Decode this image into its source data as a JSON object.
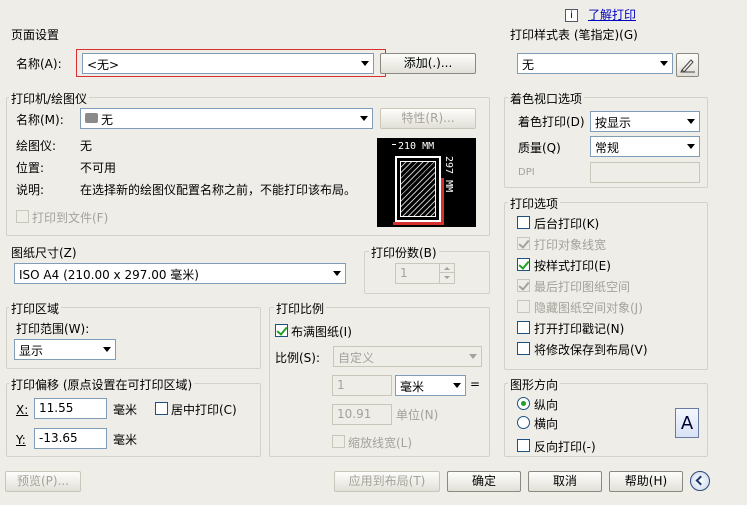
{
  "help_link": {
    "icon": "info-icon",
    "label": "了解打印"
  },
  "page_setup": {
    "title": "页面设置",
    "name_label": "名称(A):",
    "name_value": "<无>",
    "add_button": "添加(.)..."
  },
  "printer": {
    "title": "打印机/绘图仪",
    "name_label": "名称(M):",
    "name_value": "无",
    "properties_button": "特性(R)...",
    "plotter_label": "绘图仪:",
    "plotter_value": "无",
    "location_label": "位置:",
    "location_value": "不可用",
    "description_label": "说明:",
    "description_value": "在选择新的绘图仪配置名称之前，不能打印该布局。",
    "print_to_file": "打印到文件(F)",
    "preview_width": "210 MM",
    "preview_height": "297 MM"
  },
  "paper_size": {
    "title": "图纸尺寸(Z)",
    "value": "ISO A4 (210.00 x 297.00 毫米)"
  },
  "copies": {
    "title": "打印份数(B)",
    "value": "1"
  },
  "plot_area": {
    "title": "打印区域",
    "range_label": "打印范围(W):",
    "range_value": "显示"
  },
  "plot_offset": {
    "title": "打印偏移 (原点设置在可打印区域)",
    "x_label": "X:",
    "x_value": "11.55",
    "x_unit": "毫米",
    "y_label": "Y:",
    "y_value": "-13.65",
    "y_unit": "毫米",
    "center": "居中打印(C)"
  },
  "plot_scale": {
    "title": "打印比例",
    "fit_paper": "布满图纸(I)",
    "scale_label": "比例(S):",
    "scale_value": "自定义",
    "value1": "1",
    "unit1": "毫米",
    "equals": "=",
    "value2": "10.91",
    "unit2": "单位(N)",
    "scale_lineweights": "缩放线宽(L)"
  },
  "style_table": {
    "title": "打印样式表 (笔指定)(G)",
    "value": "无"
  },
  "shaded_viewport": {
    "title": "着色视口选项",
    "shade_label": "着色打印(D)",
    "shade_value": "按显示",
    "quality_label": "质量(Q)",
    "quality_value": "常规",
    "dpi_label": "DPI"
  },
  "plot_options": {
    "title": "打印选项",
    "items": [
      {
        "label": "后台打印(K)",
        "checked": false,
        "disabled": false
      },
      {
        "label": "打印对象线宽",
        "checked": true,
        "disabled": true
      },
      {
        "label": "按样式打印(E)",
        "checked": true,
        "disabled": false
      },
      {
        "label": "最后打印图纸空间",
        "checked": true,
        "disabled": true
      },
      {
        "label": "隐藏图纸空间对象(J)",
        "checked": false,
        "disabled": true
      },
      {
        "label": "打开打印戳记(N)",
        "checked": false,
        "disabled": false
      },
      {
        "label": "将修改保存到布局(V)",
        "checked": false,
        "disabled": false
      }
    ]
  },
  "orientation": {
    "title": "图形方向",
    "portrait": "纵向",
    "landscape": "横向",
    "reverse": "反向打印(-)",
    "icon_letter": "A"
  },
  "buttons": {
    "preview": "预览(P)...",
    "apply_layout": "应用到布局(T)",
    "ok": "确定",
    "cancel": "取消",
    "help": "帮助(H)"
  },
  "colors": {
    "highlight_border": "#d9302f",
    "link": "#0000c0",
    "check": "#21a121"
  }
}
